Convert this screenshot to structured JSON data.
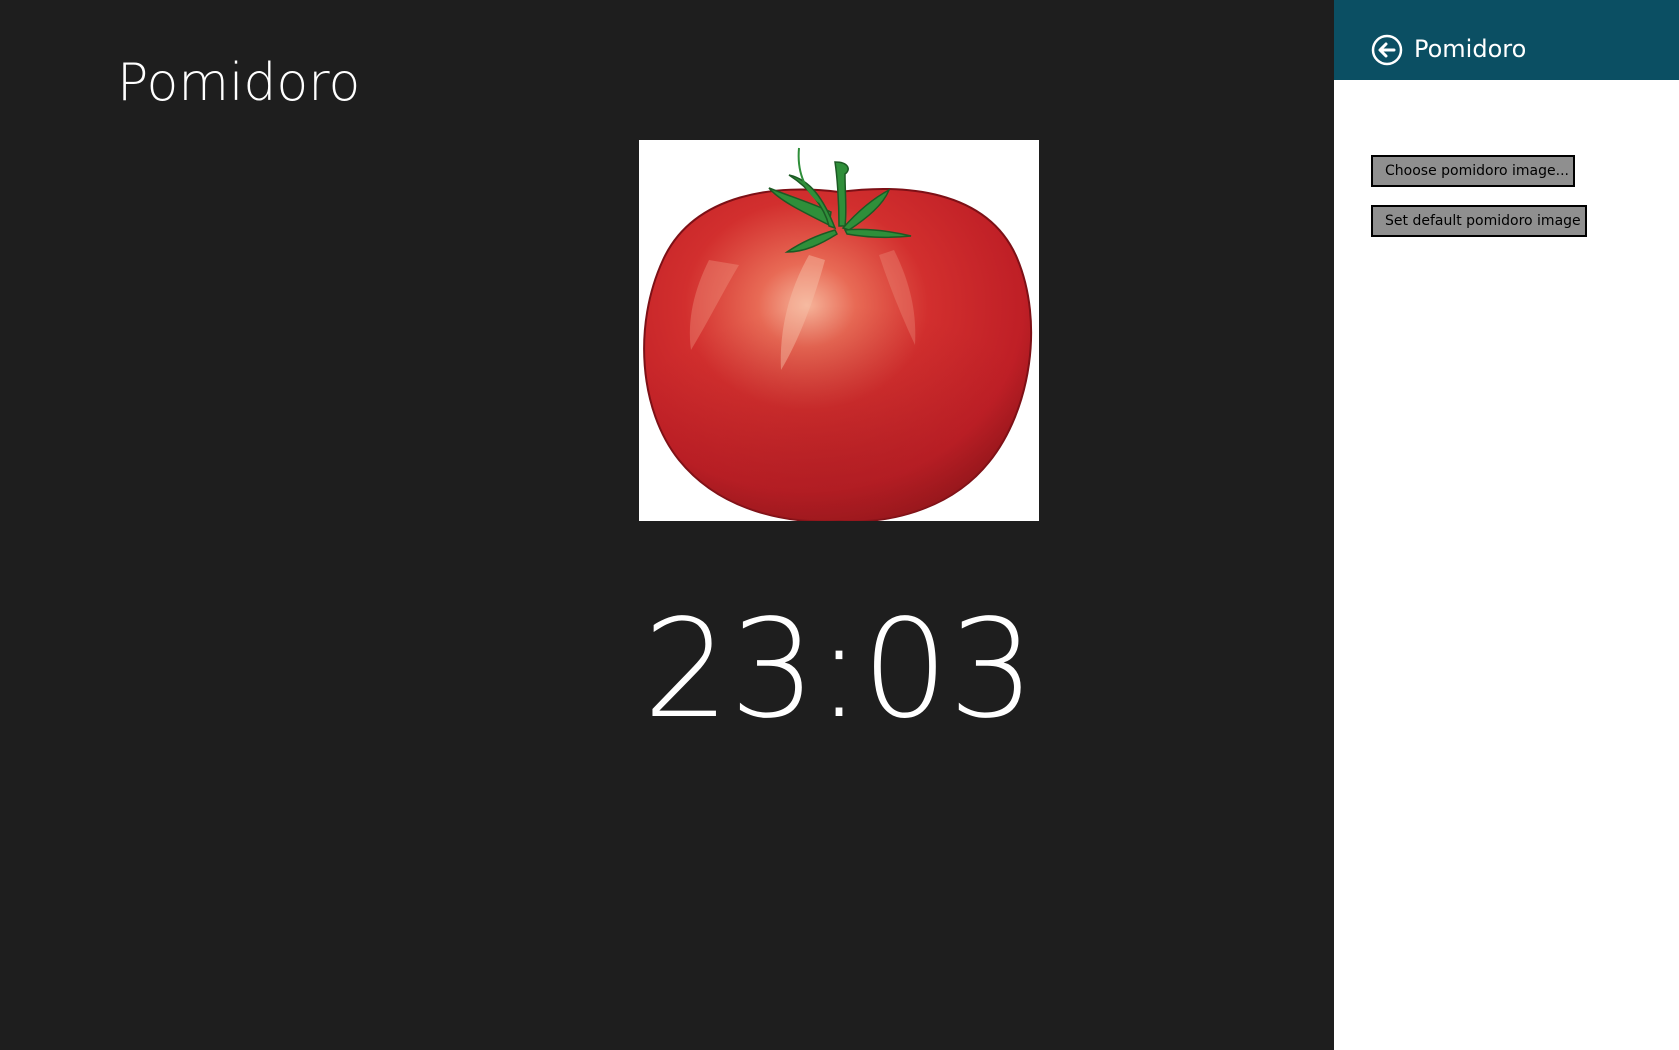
{
  "app": {
    "title": "Pomidoro",
    "timer": "23:03"
  },
  "image": {
    "icon": "tomato-image",
    "colors": {
      "fruit": "#c8232a",
      "highlight": "#f3a48a",
      "stem": "#2f8f3a",
      "background": "#ffffff"
    }
  },
  "flyout": {
    "title": "Pomidoro",
    "back_icon": "back-arrow-icon",
    "choose_label": "Choose pomidoro image...",
    "default_label": "Set default pomidoro image"
  },
  "colors": {
    "app_background": "#1e1e1e",
    "flyout_header": "#0b4f63",
    "flyout_background": "#ffffff",
    "button_background": "#8f8f8f",
    "progress": "#b8d4ee"
  }
}
